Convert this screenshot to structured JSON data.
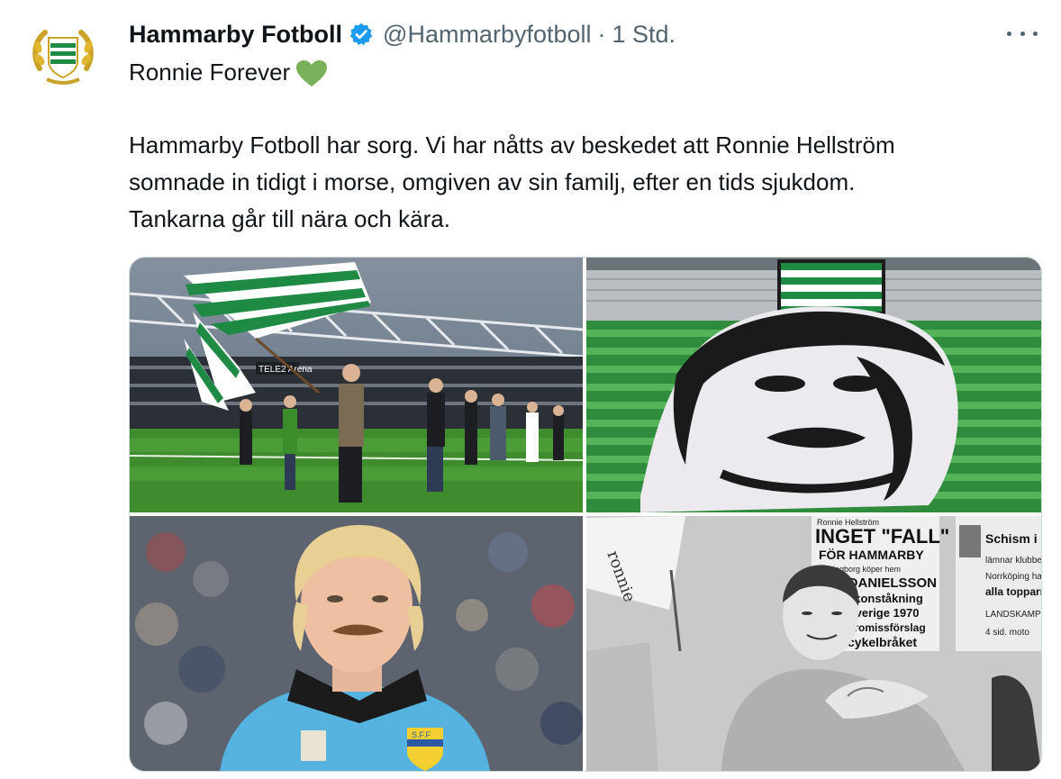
{
  "author": {
    "display_name": "Hammarby Fotboll",
    "handle": "@Hammarbyfotboll",
    "separator": "·",
    "timestamp": "1 Std.",
    "verified": true,
    "verified_color": "#1d9bf0"
  },
  "tweet": {
    "line1": "Ronnie Forever",
    "line1_emoji": "green-heart",
    "body_lines": [
      "Hammarby Fotboll har sorg. Vi har nåtts av beskedet att Ronnie Hellström",
      "somnade in tidigt i morse, omgiven av sin familj, efter en tids sjukdom.",
      "Tankarna går till nära och kära."
    ]
  },
  "media": {
    "photos": [
      {
        "description_icon": "stadium-flags-photo",
        "printed_text": "TELE2 Arena"
      },
      {
        "description_icon": "tifo-banner-photo"
      },
      {
        "description_icon": "goalkeeper-portrait-photo",
        "badge_text": "S.F.F"
      },
      {
        "description_icon": "newspaper-wall-photo",
        "newspaper_headlines": [
          "Ronnie Hellström",
          "INGET \"FALL\"",
          "FÖR HAMMARBY",
          "Hälsingborg köper hem",
          "AGE DANIELSSON",
          "i konståkning",
          "Sverige 1970",
          "promissförslag",
          "cykelbråket"
        ],
        "side_headlines": [
          "Schism i ÖIS",
          "lämnar klubbe",
          "Norrköping ha",
          "alla topparn",
          "LANDSKAMPE",
          "4 sid. moto"
        ],
        "sign_text": "ronnie"
      }
    ]
  },
  "colors": {
    "brand_green": "#1f8a44",
    "heart_green": "#78b159",
    "muted_text": "#536471"
  }
}
